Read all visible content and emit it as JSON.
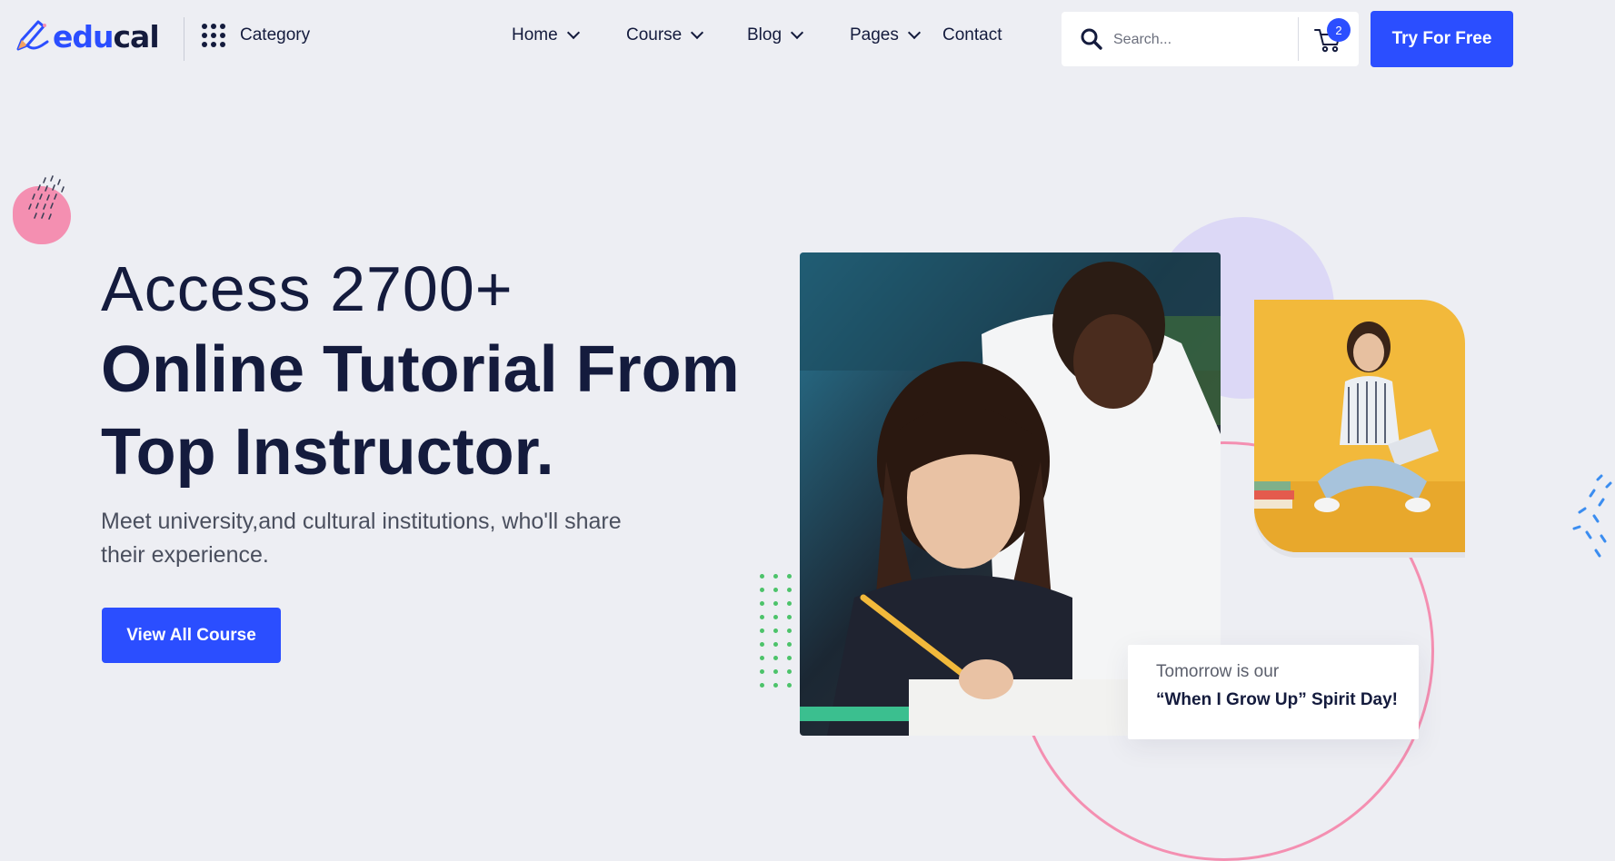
{
  "brand": {
    "name_part1": "edu",
    "name_part2": "cal",
    "primary_color": "#2b4eff",
    "dark_color": "#141b3d"
  },
  "category": {
    "label": "Category",
    "icon": "grid-dots-icon"
  },
  "nav": [
    {
      "label": "Home",
      "has_dropdown": true
    },
    {
      "label": "Course",
      "has_dropdown": true
    },
    {
      "label": "Blog",
      "has_dropdown": true
    },
    {
      "label": "Pages",
      "has_dropdown": true
    },
    {
      "label": "Contact",
      "has_dropdown": false
    }
  ],
  "search": {
    "placeholder": "Search...",
    "icon": "search-icon"
  },
  "cart": {
    "count": "2",
    "icon": "cart-icon"
  },
  "cta": {
    "label": "Try For Free"
  },
  "hero": {
    "line1": "Access 2700+",
    "line2": "Online Tutorial From",
    "line3": "Top Instructor.",
    "description": "Meet university,and cultural institutions, who'll share their experience.",
    "button_label": "View All Course"
  },
  "quote_card": {
    "small_text": "Tomorrow is our",
    "bold_text": "“When I Grow Up” Spirit Day!"
  },
  "decor_colors": {
    "pink": "#f48fb1",
    "lavender": "#dcd8f6",
    "green": "#4cc36a",
    "yellow": "#f2b93b"
  }
}
